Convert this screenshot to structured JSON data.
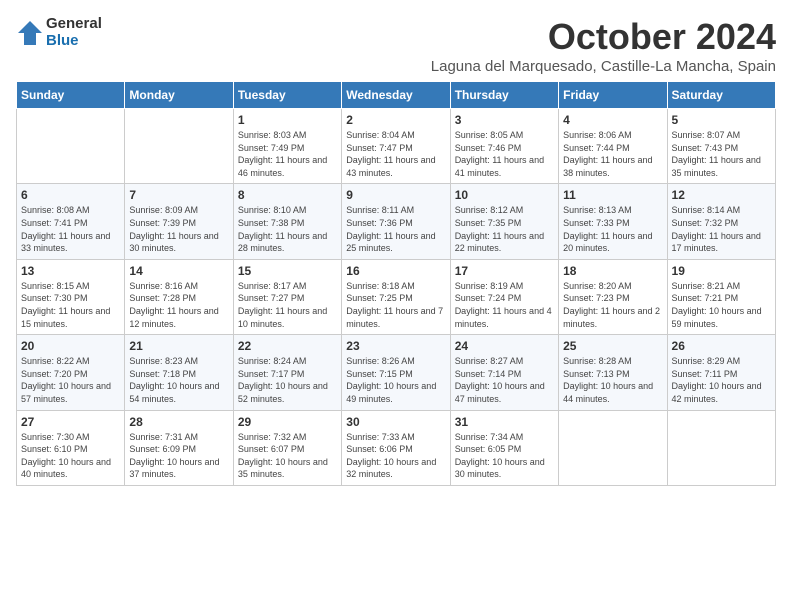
{
  "logo": {
    "general": "General",
    "blue": "Blue"
  },
  "title": "October 2024",
  "subtitle": "Laguna del Marquesado, Castille-La Mancha, Spain",
  "days_of_week": [
    "Sunday",
    "Monday",
    "Tuesday",
    "Wednesday",
    "Thursday",
    "Friday",
    "Saturday"
  ],
  "weeks": [
    [
      {
        "day": "",
        "info": ""
      },
      {
        "day": "",
        "info": ""
      },
      {
        "day": "1",
        "info": "Sunrise: 8:03 AM\nSunset: 7:49 PM\nDaylight: 11 hours and 46 minutes."
      },
      {
        "day": "2",
        "info": "Sunrise: 8:04 AM\nSunset: 7:47 PM\nDaylight: 11 hours and 43 minutes."
      },
      {
        "day": "3",
        "info": "Sunrise: 8:05 AM\nSunset: 7:46 PM\nDaylight: 11 hours and 41 minutes."
      },
      {
        "day": "4",
        "info": "Sunrise: 8:06 AM\nSunset: 7:44 PM\nDaylight: 11 hours and 38 minutes."
      },
      {
        "day": "5",
        "info": "Sunrise: 8:07 AM\nSunset: 7:43 PM\nDaylight: 11 hours and 35 minutes."
      }
    ],
    [
      {
        "day": "6",
        "info": "Sunrise: 8:08 AM\nSunset: 7:41 PM\nDaylight: 11 hours and 33 minutes."
      },
      {
        "day": "7",
        "info": "Sunrise: 8:09 AM\nSunset: 7:39 PM\nDaylight: 11 hours and 30 minutes."
      },
      {
        "day": "8",
        "info": "Sunrise: 8:10 AM\nSunset: 7:38 PM\nDaylight: 11 hours and 28 minutes."
      },
      {
        "day": "9",
        "info": "Sunrise: 8:11 AM\nSunset: 7:36 PM\nDaylight: 11 hours and 25 minutes."
      },
      {
        "day": "10",
        "info": "Sunrise: 8:12 AM\nSunset: 7:35 PM\nDaylight: 11 hours and 22 minutes."
      },
      {
        "day": "11",
        "info": "Sunrise: 8:13 AM\nSunset: 7:33 PM\nDaylight: 11 hours and 20 minutes."
      },
      {
        "day": "12",
        "info": "Sunrise: 8:14 AM\nSunset: 7:32 PM\nDaylight: 11 hours and 17 minutes."
      }
    ],
    [
      {
        "day": "13",
        "info": "Sunrise: 8:15 AM\nSunset: 7:30 PM\nDaylight: 11 hours and 15 minutes."
      },
      {
        "day": "14",
        "info": "Sunrise: 8:16 AM\nSunset: 7:28 PM\nDaylight: 11 hours and 12 minutes."
      },
      {
        "day": "15",
        "info": "Sunrise: 8:17 AM\nSunset: 7:27 PM\nDaylight: 11 hours and 10 minutes."
      },
      {
        "day": "16",
        "info": "Sunrise: 8:18 AM\nSunset: 7:25 PM\nDaylight: 11 hours and 7 minutes."
      },
      {
        "day": "17",
        "info": "Sunrise: 8:19 AM\nSunset: 7:24 PM\nDaylight: 11 hours and 4 minutes."
      },
      {
        "day": "18",
        "info": "Sunrise: 8:20 AM\nSunset: 7:23 PM\nDaylight: 11 hours and 2 minutes."
      },
      {
        "day": "19",
        "info": "Sunrise: 8:21 AM\nSunset: 7:21 PM\nDaylight: 10 hours and 59 minutes."
      }
    ],
    [
      {
        "day": "20",
        "info": "Sunrise: 8:22 AM\nSunset: 7:20 PM\nDaylight: 10 hours and 57 minutes."
      },
      {
        "day": "21",
        "info": "Sunrise: 8:23 AM\nSunset: 7:18 PM\nDaylight: 10 hours and 54 minutes."
      },
      {
        "day": "22",
        "info": "Sunrise: 8:24 AM\nSunset: 7:17 PM\nDaylight: 10 hours and 52 minutes."
      },
      {
        "day": "23",
        "info": "Sunrise: 8:26 AM\nSunset: 7:15 PM\nDaylight: 10 hours and 49 minutes."
      },
      {
        "day": "24",
        "info": "Sunrise: 8:27 AM\nSunset: 7:14 PM\nDaylight: 10 hours and 47 minutes."
      },
      {
        "day": "25",
        "info": "Sunrise: 8:28 AM\nSunset: 7:13 PM\nDaylight: 10 hours and 44 minutes."
      },
      {
        "day": "26",
        "info": "Sunrise: 8:29 AM\nSunset: 7:11 PM\nDaylight: 10 hours and 42 minutes."
      }
    ],
    [
      {
        "day": "27",
        "info": "Sunrise: 7:30 AM\nSunset: 6:10 PM\nDaylight: 10 hours and 40 minutes."
      },
      {
        "day": "28",
        "info": "Sunrise: 7:31 AM\nSunset: 6:09 PM\nDaylight: 10 hours and 37 minutes."
      },
      {
        "day": "29",
        "info": "Sunrise: 7:32 AM\nSunset: 6:07 PM\nDaylight: 10 hours and 35 minutes."
      },
      {
        "day": "30",
        "info": "Sunrise: 7:33 AM\nSunset: 6:06 PM\nDaylight: 10 hours and 32 minutes."
      },
      {
        "day": "31",
        "info": "Sunrise: 7:34 AM\nSunset: 6:05 PM\nDaylight: 10 hours and 30 minutes."
      },
      {
        "day": "",
        "info": ""
      },
      {
        "day": "",
        "info": ""
      }
    ]
  ]
}
